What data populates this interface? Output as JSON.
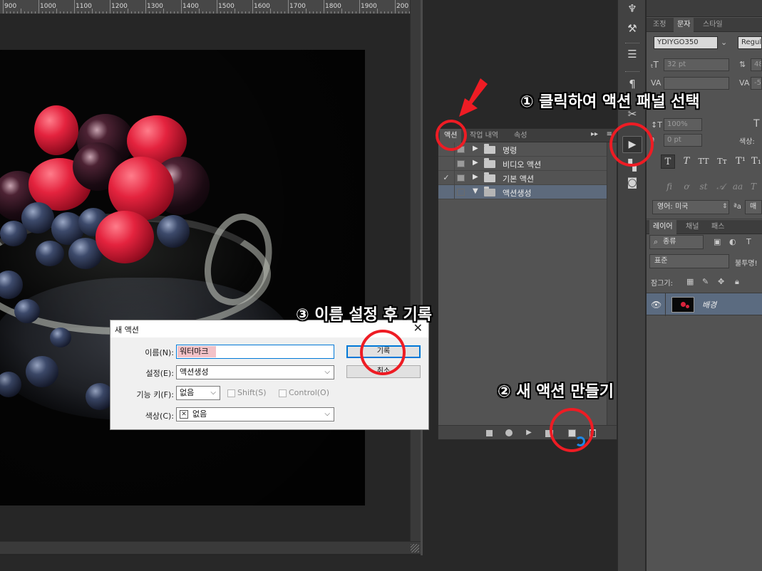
{
  "ruler": {
    "labels": [
      "900",
      "1000",
      "1100",
      "1200",
      "1300",
      "1400",
      "1500",
      "1600",
      "1700",
      "1800",
      "1900",
      "200"
    ]
  },
  "actions_panel": {
    "tabs": [
      "액션",
      "작업 내역",
      "속성"
    ],
    "items": [
      {
        "label": "명령",
        "checked": false,
        "expanded": false
      },
      {
        "label": "비디오 액션",
        "checked": false,
        "expanded": false
      },
      {
        "label": "기본 액션",
        "checked": true,
        "expanded": false
      },
      {
        "label": "액션생성",
        "checked": false,
        "expanded": true
      }
    ],
    "check_mark": "✓"
  },
  "char_panel": {
    "tabs": [
      "조정",
      "문자",
      "스타일"
    ],
    "font_family": "YDIYGO350",
    "font_style": "Regula",
    "font_size": "32 pt",
    "leading": "48 p",
    "kerning_placeholder": "",
    "tracking": "-50",
    "vertical_scale": "100%",
    "baseline": "0 pt",
    "color_label": "색상:",
    "language": "영어: 미국",
    "aa_label": "ªa",
    "aa_value": "매"
  },
  "layers_panel": {
    "tabs": [
      "레이어",
      "채널",
      "패스"
    ],
    "filter": "종류",
    "blend_mode": "표준",
    "opacity_label": "불투명!",
    "lock_label": "잠그기:",
    "layer_name": "배경"
  },
  "dialog": {
    "title": "새 액션",
    "name_label": "이름(N):",
    "name_value": "워터마크",
    "set_label": "설정(E):",
    "set_value": "액션생성",
    "fkey_label": "기능 키(F):",
    "fkey_value": "없음",
    "shift_label": "Shift(S)",
    "control_label": "Control(O)",
    "color_label": "색상(C):",
    "color_value": "없음",
    "record_button": "기록",
    "cancel_button": "취소"
  },
  "annotations": {
    "step1": "① 클릭하여 액션 패널 선택",
    "step2": "② 새 액션 만들기",
    "step3": "③ 이름 설정 후 기록"
  },
  "colors": {
    "highlight": "#ee1c24",
    "selection": "#5d6a7c",
    "dialog_focus": "#0078d7"
  }
}
